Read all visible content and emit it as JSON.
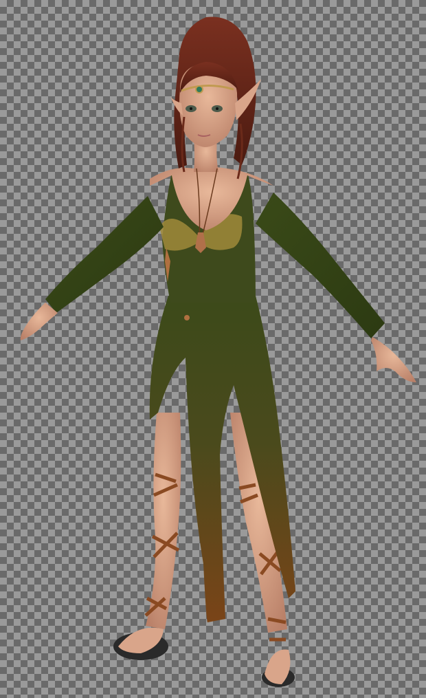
{
  "scene": {
    "subject_icon": "elf-character-figure",
    "background_pattern": "transparency-checkerboard",
    "colors": {
      "checker_light": "#9a9a9a",
      "checker_dark": "#6a6a6a",
      "dress_green": "#3f4a1c",
      "dress_brown": "#7a4a1a",
      "skin": "#d9a58a",
      "hair": "#6a2a1a",
      "straps": "#8a4a22"
    }
  }
}
